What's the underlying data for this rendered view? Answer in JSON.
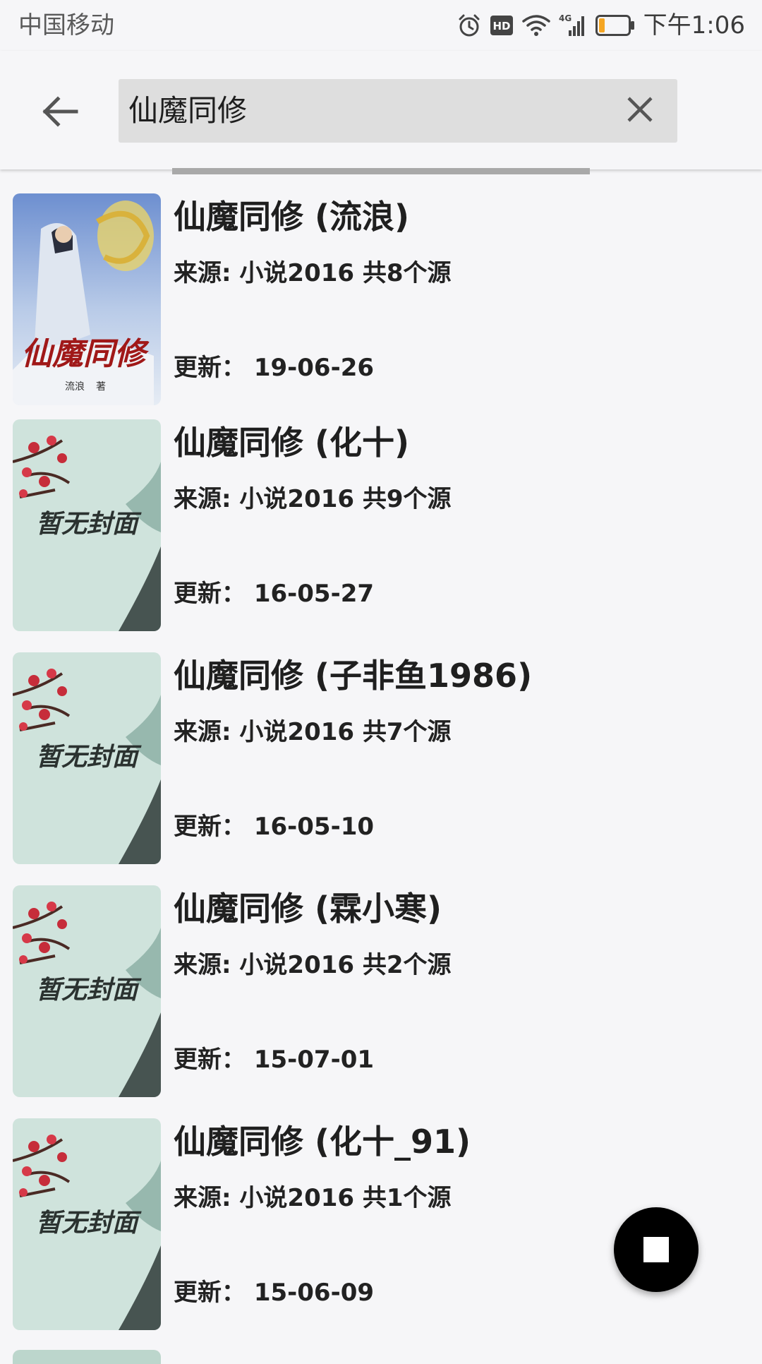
{
  "status_bar": {
    "carrier": "中国移动",
    "icons": [
      "alarm-icon",
      "hd-icon",
      "wifi-icon",
      "4g-signal-icon",
      "battery-icon"
    ],
    "hd_label": "HD",
    "network_label": "4G",
    "battery_level": 0.2,
    "time": "下午1:06"
  },
  "header": {
    "back_icon": "arrow-left-icon",
    "search_value": "仙魔同修",
    "clear_icon": "close-icon"
  },
  "results": [
    {
      "cover": "cover-xianmo-tongxiu",
      "cover_title": "仙魔同修",
      "cover_author": "流浪",
      "cover_author_suffix": "著",
      "title": "仙魔同修 (流浪)",
      "source": "来源: 小说2016  共8个源",
      "updated": "更新：  19-06-26"
    },
    {
      "cover": "cover-placeholder",
      "cover_text": "暂无封面",
      "title": "仙魔同修 (化十)",
      "source": "来源: 小说2016  共9个源",
      "updated": "更新：  16-05-27"
    },
    {
      "cover": "cover-placeholder",
      "cover_text": "暂无封面",
      "title": "仙魔同修 (子非鱼1986)",
      "source": "来源: 小说2016  共7个源",
      "updated": "更新：  16-05-10"
    },
    {
      "cover": "cover-placeholder",
      "cover_text": "暂无封面",
      "title": "仙魔同修 (霖小寒)",
      "source": "来源: 小说2016  共2个源",
      "updated": "更新：  15-07-01"
    },
    {
      "cover": "cover-placeholder",
      "cover_text": "暂无封面",
      "title": "仙魔同修 (化十_91)",
      "source": "来源: 小说2016  共1个源",
      "updated": "更新：  15-06-09"
    }
  ],
  "fab": {
    "icon": "stop-icon"
  },
  "colors": {
    "background": "#f6f6f8",
    "search_box": "#dedede",
    "progress": "#a9a9a9",
    "battery_low": "#f5a623",
    "fab": "#000000"
  }
}
